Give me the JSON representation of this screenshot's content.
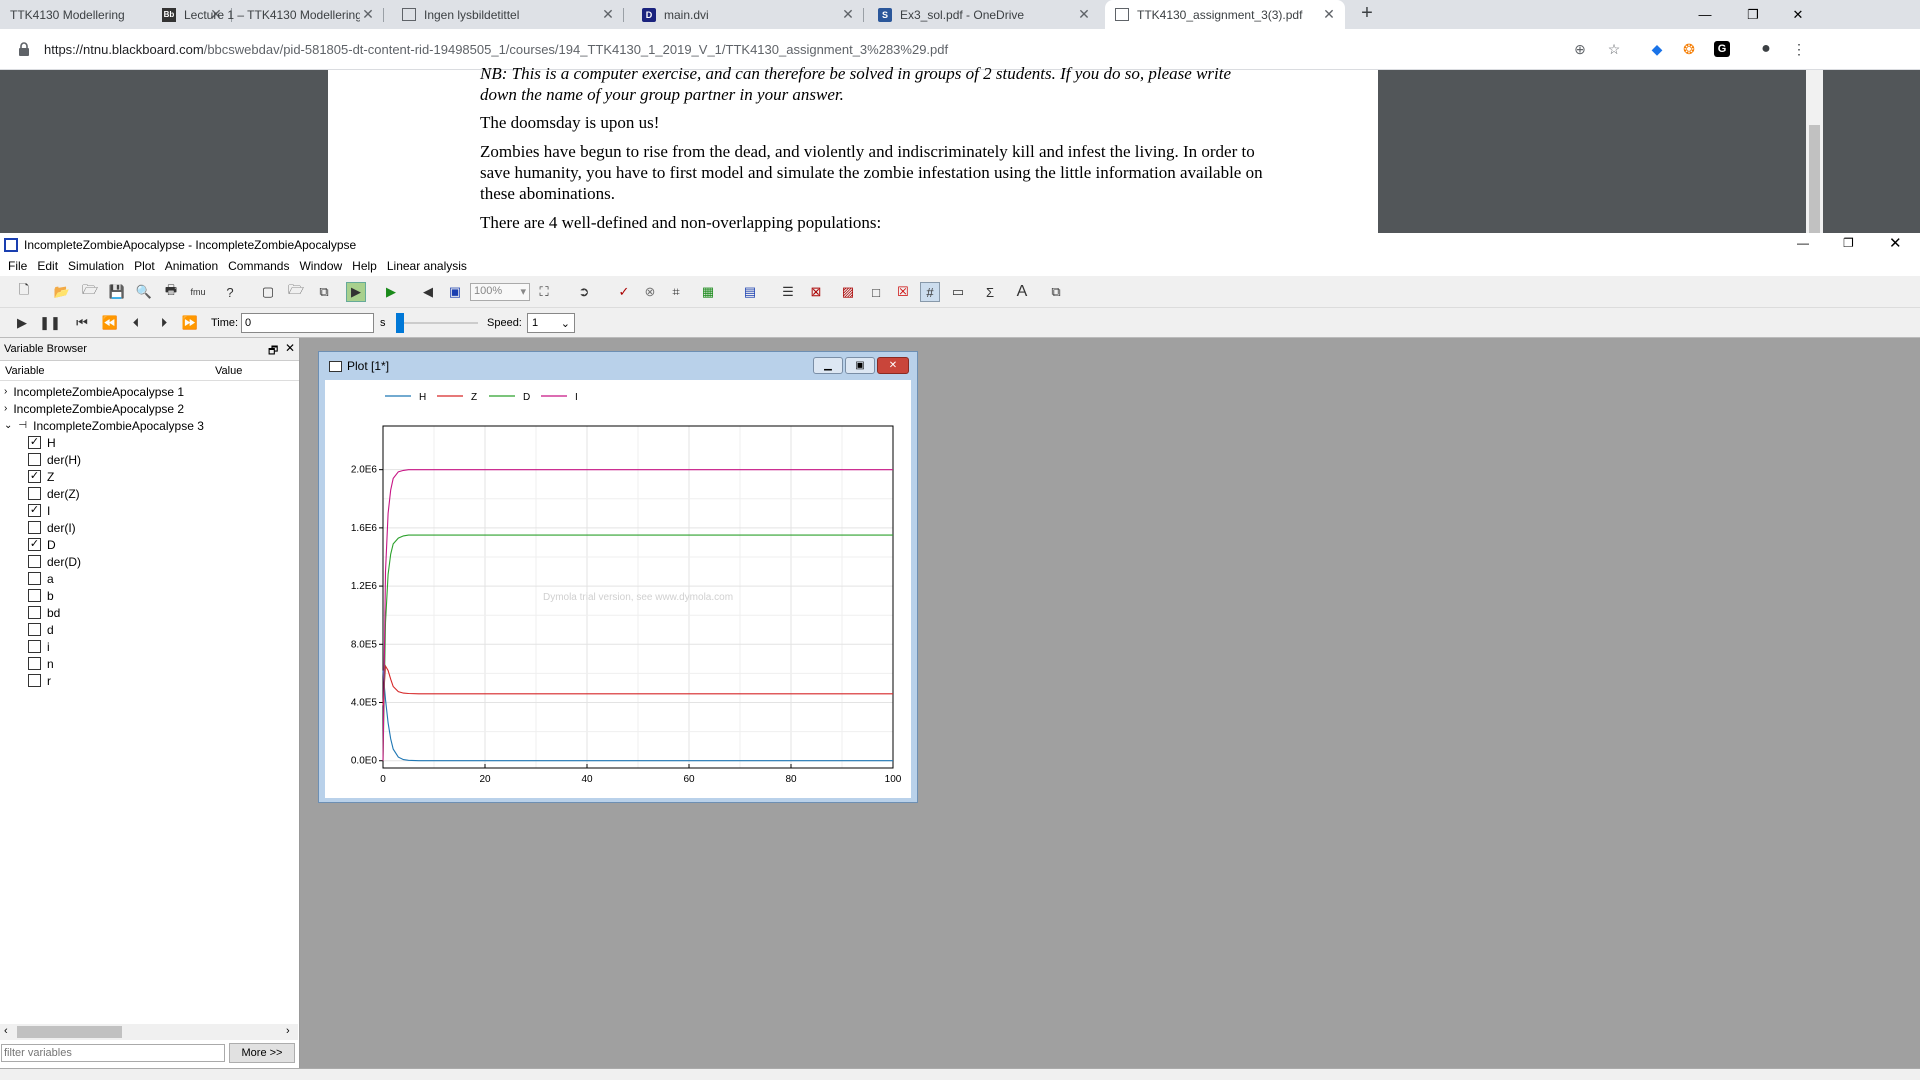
{
  "browser": {
    "tabs": [
      {
        "title": "TTK4130 Modellering",
        "favicon": "page"
      },
      {
        "title": "Lecture 1 – TTK4130 Modellering",
        "favicon": "Bb"
      },
      {
        "title": "Ingen lysbildetittel",
        "favicon": "page"
      },
      {
        "title": "main.dvi",
        "favicon": "D"
      },
      {
        "title": "Ex3_sol.pdf - OneDrive",
        "favicon": "S"
      },
      {
        "title": "TTK4130_assignment_3(3).pdf",
        "favicon": "page",
        "active": true
      }
    ],
    "url_domain": "https://ntnu.blackboard.com",
    "url_path": "/bbcswebdav/pid-581805-dt-content-rid-19498505_1/courses/194_TTK4130_1_2019_V_1/TTK4130_assignment_3%283%29.pdf"
  },
  "pdf": {
    "line1": "NB: This is a computer exercise, and can therefore be solved in groups of 2 students. If you do so, please write",
    "line2": "down the name of your group partner in your answer.",
    "para2": "The doomsday is upon us!",
    "para3": "Zombies have begun to rise from the dead, and violently and indiscriminately kill and infest the living. In order to save humanity, you have to first model and simulate the zombie infestation using the little information available on these abominations.",
    "para4": "There are 4 well-defined and non-overlapping populations:"
  },
  "dymola": {
    "title": "IncompleteZombieApocalypse - IncompleteZombieApocalypse",
    "menu": [
      "File",
      "Edit",
      "Simulation",
      "Plot",
      "Animation",
      "Commands",
      "Window",
      "Help",
      "Linear analysis"
    ],
    "zoom": "100%",
    "time_label": "Time:",
    "time_value": "0",
    "time_unit": "s",
    "speed_label": "Speed:",
    "speed_value": "1"
  },
  "variable_browser": {
    "title": "Variable Browser",
    "col_variable": "Variable",
    "col_value": "Value",
    "roots": [
      "IncompleteZombieApocalypse 1",
      "IncompleteZombieApocalypse 2",
      "IncompleteZombieApocalypse 3"
    ],
    "vars": [
      {
        "name": "H",
        "checked": true
      },
      {
        "name": "der(H)",
        "checked": false
      },
      {
        "name": "Z",
        "checked": true
      },
      {
        "name": "der(Z)",
        "checked": false
      },
      {
        "name": "I",
        "checked": true
      },
      {
        "name": "der(I)",
        "checked": false
      },
      {
        "name": "D",
        "checked": true
      },
      {
        "name": "der(D)",
        "checked": false
      },
      {
        "name": "a",
        "checked": false
      },
      {
        "name": "b",
        "checked": false
      },
      {
        "name": "bd",
        "checked": false
      },
      {
        "name": "d",
        "checked": false
      },
      {
        "name": "i",
        "checked": false
      },
      {
        "name": "n",
        "checked": false
      },
      {
        "name": "r",
        "checked": false
      }
    ],
    "filter_placeholder": "filter variables",
    "more_button": "More >>"
  },
  "plot": {
    "window_title": "Plot [1*]",
    "watermark": "Dymola trial version, see www.dymola.com"
  },
  "chart_data": {
    "type": "line",
    "xlim": [
      0,
      100
    ],
    "ylim": [
      -50000,
      2300000
    ],
    "x_ticks": [
      "0",
      "20",
      "40",
      "60",
      "80",
      "100"
    ],
    "y_ticks": [
      {
        "v": 0,
        "label": "0.0E0"
      },
      {
        "v": 400000,
        "label": "4.0E5"
      },
      {
        "v": 800000,
        "label": "8.0E5"
      },
      {
        "v": 1200000,
        "label": "1.2E6"
      },
      {
        "v": 1600000,
        "label": "1.6E6"
      },
      {
        "v": 2000000,
        "label": "2.0E6"
      }
    ],
    "grid": true,
    "legend_position": "top",
    "series": [
      {
        "name": "H",
        "color": "#1f77b4",
        "x": [
          0,
          0.5,
          1,
          1.5,
          2,
          3,
          4,
          5,
          7,
          100
        ],
        "y": [
          620000,
          420000,
          260000,
          150000,
          80000,
          25000,
          8000,
          3000,
          0,
          0
        ]
      },
      {
        "name": "Z",
        "color": "#d62728",
        "x": [
          0,
          0.5,
          1,
          1.5,
          2,
          3,
          4,
          5,
          7,
          100
        ],
        "y": [
          380000,
          650000,
          620000,
          560000,
          510000,
          475000,
          465000,
          462000,
          460000,
          460000
        ]
      },
      {
        "name": "D",
        "color": "#2ca02c",
        "x": [
          0,
          0.5,
          1,
          1.5,
          2,
          3,
          4,
          5,
          7,
          100
        ],
        "y": [
          0,
          950000,
          1280000,
          1420000,
          1490000,
          1530000,
          1545000,
          1550000,
          1550000,
          1550000
        ]
      },
      {
        "name": "I",
        "color": "#c71585",
        "x": [
          0,
          0.5,
          1,
          1.5,
          2,
          3,
          4,
          5,
          7,
          100
        ],
        "y": [
          0,
          1300000,
          1700000,
          1860000,
          1940000,
          1985000,
          1995000,
          2000000,
          2000000,
          2000000
        ]
      }
    ]
  }
}
